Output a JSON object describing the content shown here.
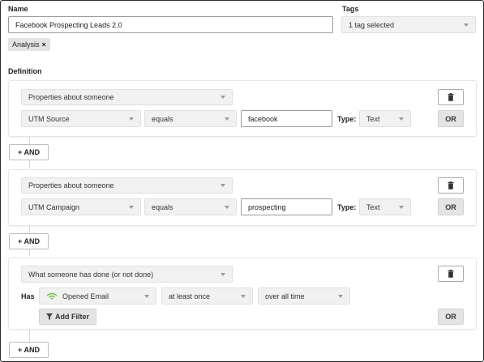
{
  "name_label": "Name",
  "name_value": "Facebook Prospecting Leads 2.0",
  "tags_label": "Tags",
  "tags_select": "1 tag selected",
  "tag_chip": {
    "label": "Analysis",
    "remove": "×"
  },
  "definition_label": "Definition",
  "conditions": [
    {
      "kind": "Properties about someone",
      "property": "UTM Source",
      "operator": "equals",
      "value": "facebook",
      "type_label": "Type:",
      "type_value": "Text",
      "or_label": "OR"
    },
    {
      "kind": "Properties about someone",
      "property": "UTM Campaign",
      "operator": "equals",
      "value": "prospecting",
      "type_label": "Type:",
      "type_value": "Text",
      "or_label": "OR"
    },
    {
      "kind": "What someone has done (or not done)",
      "has_label": "Has",
      "event": "Opened Email",
      "frequency": "at least once",
      "timeframe": "over all time",
      "add_filter_label": "Add Filter",
      "or_label": "OR"
    }
  ],
  "and_label": "+ AND",
  "icons": {
    "trash": "trash-icon",
    "email_event": "opened-email-icon",
    "filter": "filter-icon",
    "dropdown": "chevron-down-icon"
  },
  "colors": {
    "email_icon": "#6fbf4a",
    "button_gray": "#e4e4e4",
    "select_bg": "#f1f1f1"
  }
}
